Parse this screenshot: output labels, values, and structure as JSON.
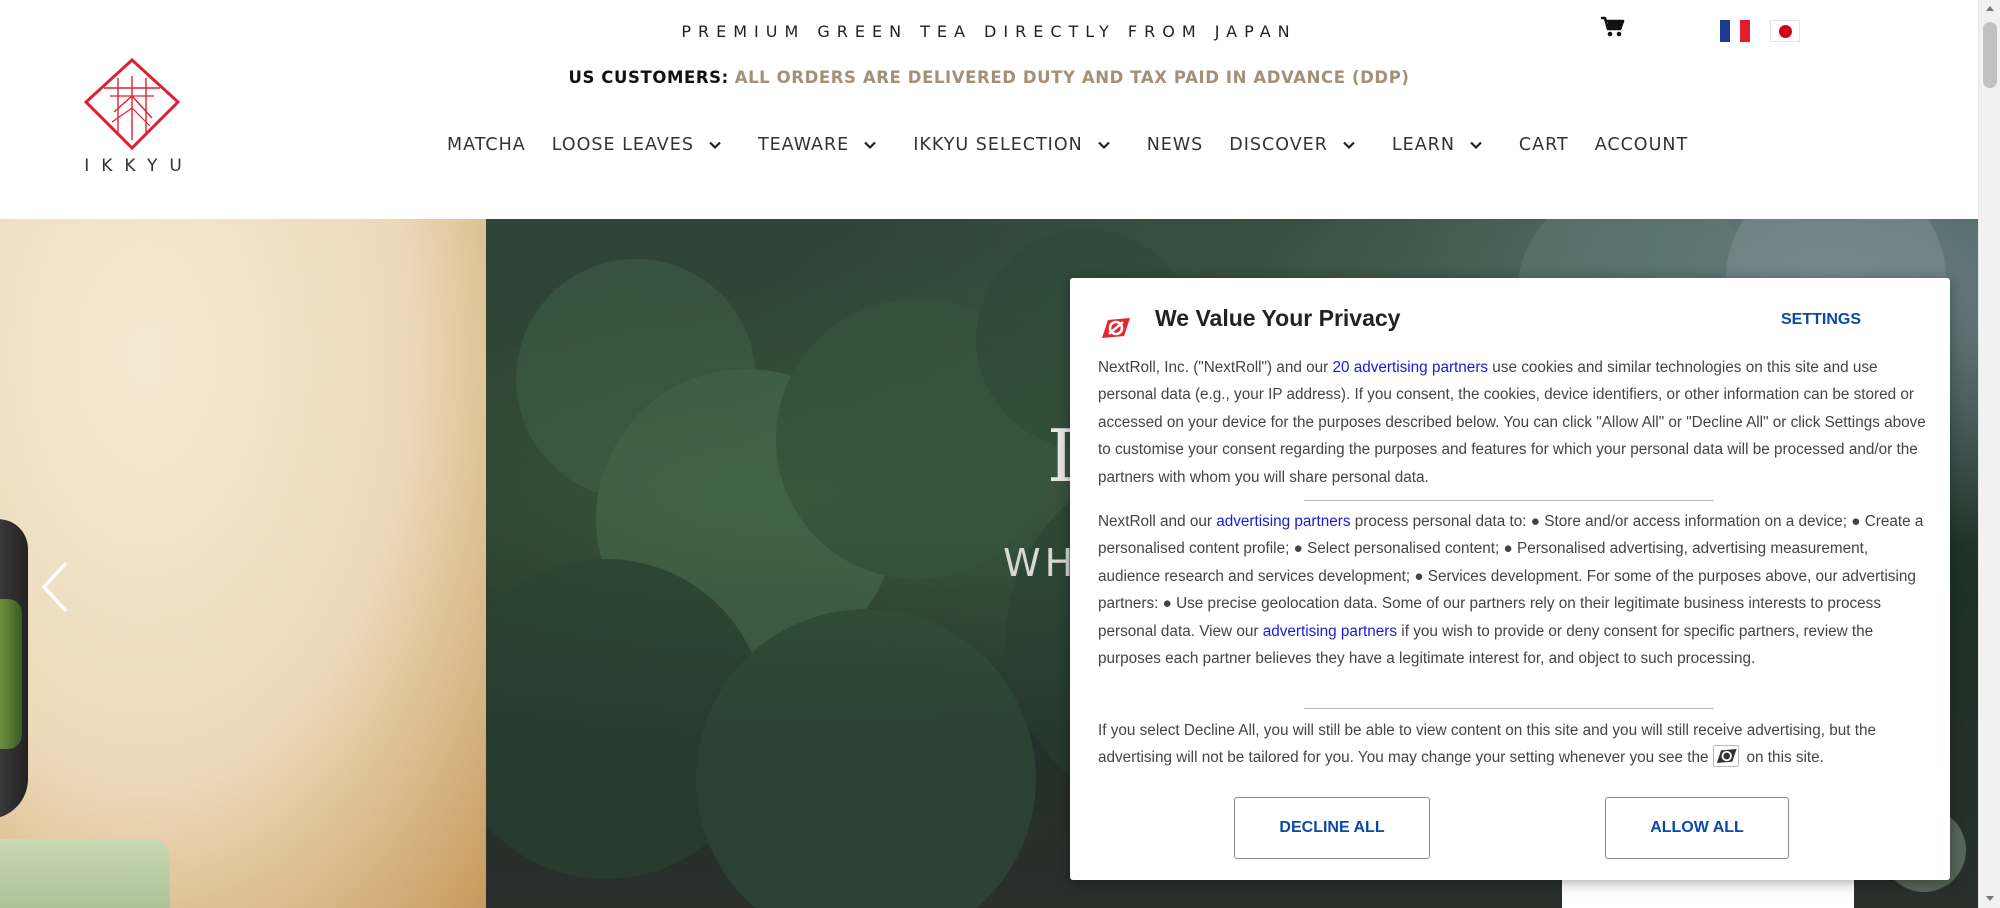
{
  "header": {
    "tagline": "PREMIUM GREEN TEA DIRECTLY FROM JAPAN",
    "ddp_label": "US CUSTOMERS:",
    "ddp_text": "ALL ORDERS ARE DELIVERED DUTY AND TAX PAID IN ADVANCE (DDP)",
    "logo_text": "IKKYU",
    "cart_icon": "shopping-cart-icon",
    "languages": [
      "fr",
      "jp"
    ]
  },
  "nav": {
    "items": [
      {
        "label": "MATCHA",
        "dropdown": false
      },
      {
        "label": "LOOSE LEAVES",
        "dropdown": true
      },
      {
        "label": "TEAWARE",
        "dropdown": true
      },
      {
        "label": "IKKYU SELECTION",
        "dropdown": true
      },
      {
        "label": "NEWS",
        "dropdown": false
      },
      {
        "label": "DISCOVER",
        "dropdown": true
      },
      {
        "label": "LEARN",
        "dropdown": true
      },
      {
        "label": "CART",
        "dropdown": false
      },
      {
        "label": "ACCOUNT",
        "dropdown": false
      }
    ]
  },
  "hero": {
    "title_partial": "I",
    "subtitle_partial": "WH"
  },
  "consent": {
    "title": "We Value Your Privacy",
    "settings": "SETTINGS",
    "p1_a": "NextRoll, Inc. (\"NextRoll\") and our ",
    "p1_link": "20 advertising partners",
    "p1_b": " use cookies and similar technologies on this site and use personal data (e.g., your IP address). If you consent, the cookies, device identifiers, or other information can be stored or accessed on your device for the purposes described below. You can click \"Allow All\" or \"Decline All\" or click Settings above to customise your consent regarding the purposes and features for which your personal data will be processed and/or the partners with whom you will share personal data.",
    "p2_a": "NextRoll and our ",
    "p2_link1": "advertising partners",
    "p2_b": " process personal data to: ● Store and/or access information on a device; ● Create a personalised content profile; ● Select personalised content; ● Personalised advertising, advertising measurement, audience research and services development; ● Services development. For some of the purposes above, our advertising partners: ● Use precise geolocation data. Some of our partners rely on their legitimate business interests to process personal data. View our ",
    "p2_link2": "advertising partners",
    "p2_c": " if you wish to provide or deny consent for specific partners, review the purposes each partner believes they have a legitimate interest for, and object to such processing.",
    "p3_a": "If you select Decline All, you will still be able to view content on this site and you will still receive advertising, but the advertising will not be tailored for you. You may change your setting whenever you see the",
    "p3_b": "on this site.",
    "decline": "DECLINE ALL",
    "allow": "ALLOW ALL"
  },
  "colors": {
    "accent_tan": "#a48f77",
    "logo_red": "#e0202e",
    "consent_link": "#1a1ad6",
    "consent_button_text": "#0a4aa6"
  }
}
